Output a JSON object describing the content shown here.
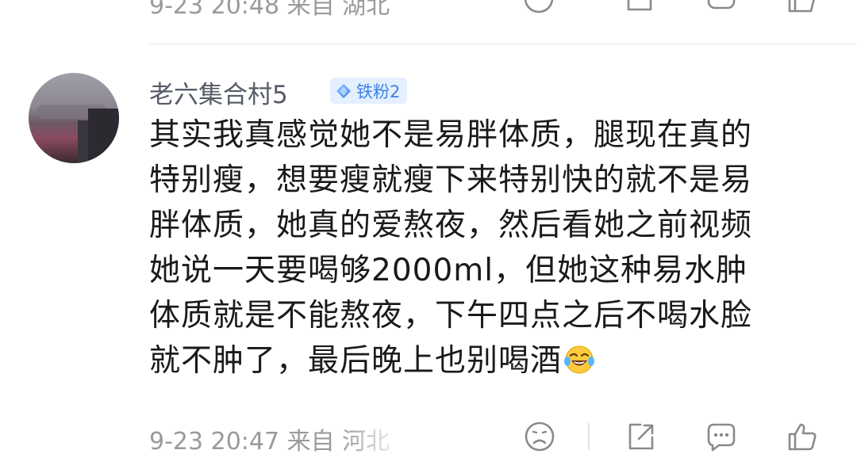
{
  "previous_comment": {
    "timestamp": "9-23 20:48",
    "location_prefix": "来自",
    "location": "湖北"
  },
  "comment": {
    "username": "老六集合村5",
    "badge": {
      "label": "铁粉2",
      "color": "#3a82e6",
      "bg": "#e4efff"
    },
    "lines": [
      "其实我真感觉她不是易胖体质，腿现在真的",
      "特别瘦，想要瘦就瘦下来特别快的就不是易",
      "胖体质，她真的爱熬夜，然后看她之前视频",
      "她说一天要喝够2000ml，但她这种易水肿",
      "体质就是不能熬夜，下午四点之后不喝水脸",
      "就不肿了，最后晚上也别喝酒"
    ],
    "trailing_emoji": "laughing-tears-emoji",
    "timestamp": "9-23 20:47",
    "location_prefix": "来自",
    "location": "河北"
  },
  "actions": [
    {
      "name": "dislike",
      "icon": "sad-face-icon"
    },
    {
      "name": "repost",
      "icon": "share-icon"
    },
    {
      "name": "reply",
      "icon": "comment-icon"
    },
    {
      "name": "like",
      "icon": "thumbs-up-icon"
    }
  ],
  "colors": {
    "meta_gray": "#9a9a9a",
    "username": "#555a66",
    "text": "#1a1a1a",
    "icon": "#8a8a8a"
  }
}
